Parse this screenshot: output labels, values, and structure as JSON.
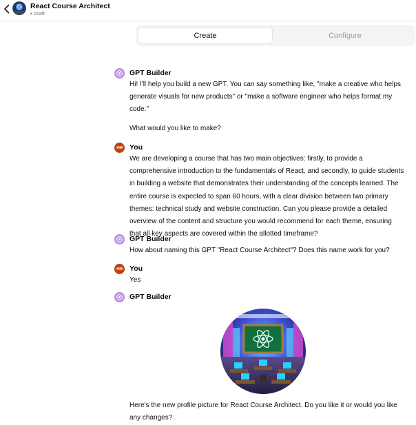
{
  "header": {
    "title": "React Course Architect",
    "subtitle": "• Draft"
  },
  "tabs": [
    {
      "label": "Create",
      "active": true
    },
    {
      "label": "Configure",
      "active": false
    }
  ],
  "icons": {
    "back": "chevron-left-icon",
    "gpt_builder": "gpt-builder-icon",
    "user_initials": "HM"
  },
  "colors": {
    "gpt_avatar": "#b98ee8",
    "user_avatar": "#c2410c",
    "tab_bg": "#f4f4f4"
  },
  "messages": [
    {
      "author": "GPT Builder",
      "role": "assistant",
      "paragraphs": [
        "Hi! I'll help you build a new GPT. You can say something like, \"make a creative who helps generate visuals for new products\" or \"make a software engineer who helps format my code.\"",
        "What would you like to make?"
      ]
    },
    {
      "author": "You",
      "role": "user",
      "paragraphs": [
        "We are developing a course that has two main objectives: firstly, to provide a comprehensive introduction to the fundamentals of React, and secondly, to guide students in building a website that demonstrates their understanding of the concepts learned. The entire course is expected to span 60 hours, with a clear division between two primary themes: technical study and website construction. Can you please provide a detailed overview of the content and structure you would recommend for each theme, ensuring that all key aspects are covered within the allotted timeframe?"
      ]
    },
    {
      "author": "GPT Builder",
      "role": "assistant",
      "paragraphs": [
        "How about naming this GPT \"React Course Architect\"? Does this name work for you?"
      ]
    },
    {
      "author": "You",
      "role": "user",
      "paragraphs": [
        "Yes"
      ]
    },
    {
      "author": "GPT Builder",
      "role": "assistant",
      "image": "generated-profile-picture",
      "paragraphs": [
        "Here's the new profile picture for React Course Architect. Do you like it or would you like any changes?"
      ]
    }
  ]
}
